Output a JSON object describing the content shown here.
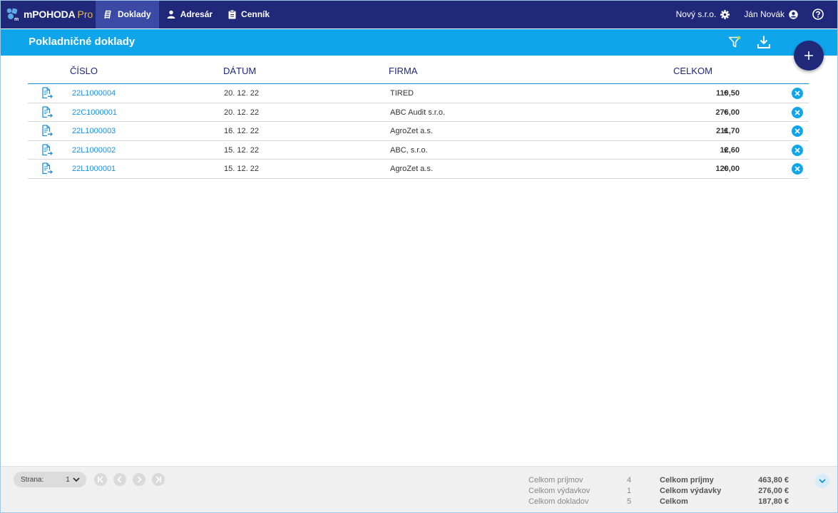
{
  "app": {
    "name": "mPOHODA",
    "edition": "Pro"
  },
  "nav": {
    "items": [
      {
        "label": "Doklady",
        "icon": "receipts-icon",
        "active": true
      },
      {
        "label": "Adresár",
        "icon": "person-icon",
        "active": false
      },
      {
        "label": "Cenník",
        "icon": "clipboard-icon",
        "active": false
      }
    ]
  },
  "header": {
    "company": "Nový s.r.o.",
    "user": "Ján Novák"
  },
  "page": {
    "title": "Pokladničné doklady"
  },
  "table": {
    "columns": {
      "number": "ČÍSLO",
      "date": "DÁTUM",
      "firm": "FIRMA",
      "total": "CELKOM"
    },
    "currency": "€",
    "rows": [
      {
        "number": "22L1000004",
        "date": "20. 12. 22",
        "firm": "TIRED",
        "amount": "119,50"
      },
      {
        "number": "22C1000001",
        "date": "20. 12. 22",
        "firm": "ABC Audit s.r.o.",
        "amount": "276,00"
      },
      {
        "number": "22L1000003",
        "date": "16. 12. 22",
        "firm": "AgroZet a.s.",
        "amount": "211,70"
      },
      {
        "number": "22L1000002",
        "date": "15. 12. 22",
        "firm": "ABC, s.r.o.",
        "amount": "12,60"
      },
      {
        "number": "22L1000001",
        "date": "15. 12. 22",
        "firm": "AgroZet a.s.",
        "amount": "120,00"
      }
    ]
  },
  "footer": {
    "page_label": "Strana:",
    "page_value": "1",
    "stats": {
      "income_count_label": "Celkom príjmov",
      "income_count": "4",
      "expense_count_label": "Celkom výdavkov",
      "expense_count": "1",
      "doc_count_label": "Celkom dokladov",
      "doc_count": "5",
      "income_sum_label": "Celkom príjmy",
      "income_sum": "463,80 €",
      "expense_sum_label": "Celkom výdavky",
      "expense_sum": "276,00 €",
      "total_label": "Celkom",
      "total": "187,80 €"
    }
  },
  "colors": {
    "nav_bg": "#20287a",
    "title_bg": "#0fa5ea",
    "link": "#1e8fd6"
  }
}
